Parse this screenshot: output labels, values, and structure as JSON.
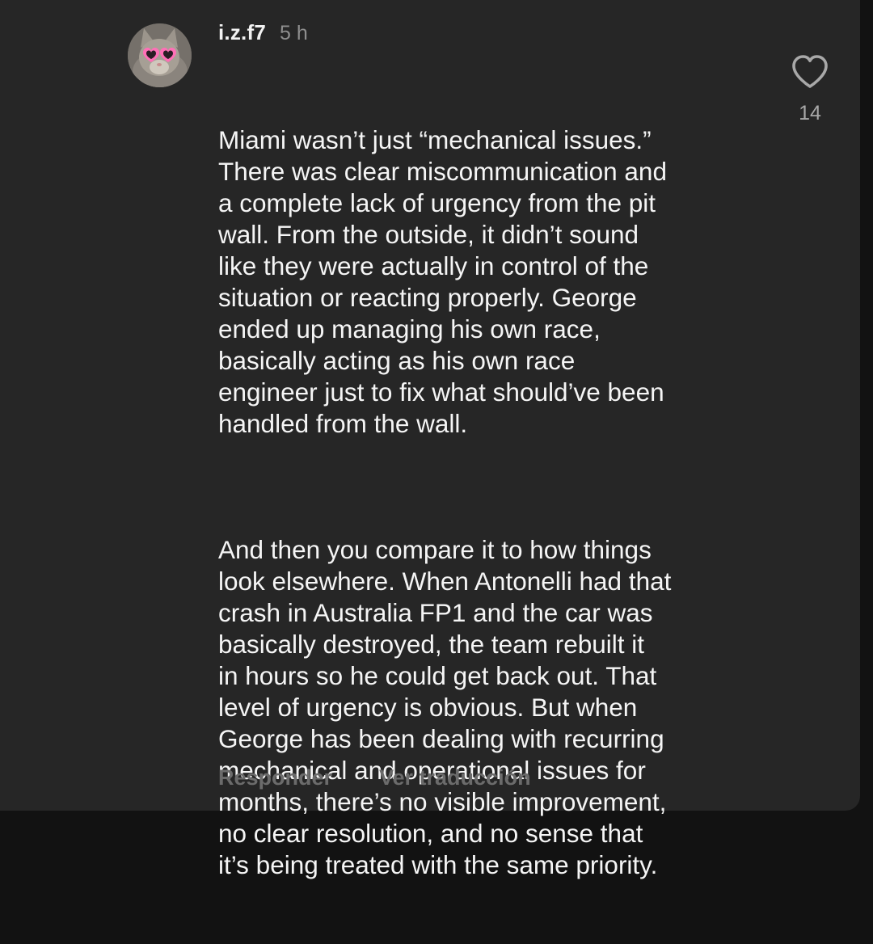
{
  "comment": {
    "author": "i.z.f7",
    "timestamp": "5 h",
    "paragraphs": [
      "Miami wasn’t just “mechanical issues.”\nThere was clear miscommunication and\na complete lack of urgency from the pit\nwall. From the outside, it didn’t sound\nlike they were actually in control of the\nsituation or reacting properly. George\nended up managing his own race,\nbasically acting as his own race\nengineer just to fix what should’ve been\nhandled from the wall.",
      "And then you compare it to how things\nlook elsewhere. When Antonelli had that\ncrash in Australia FP1 and the car was\nbasically destroyed, the team rebuilt it\nin hours so he could get back out. That\nlevel of urgency is obvious. But when\nGeorge has been dealing with recurring\nmechanical and operational issues for\nmonths, there’s no visible improvement,\nno clear resolution, and no sense that\nit’s being treated with the same priority."
    ],
    "like_icon": "heart-outline-icon",
    "like_count": "14",
    "reply_label": "Responder",
    "translate_label": "Ver traducción"
  },
  "theme": {
    "background": "#262626",
    "text": "#f5f5f5",
    "muted": "#8e8e8e",
    "action": "#6b6b6b"
  }
}
